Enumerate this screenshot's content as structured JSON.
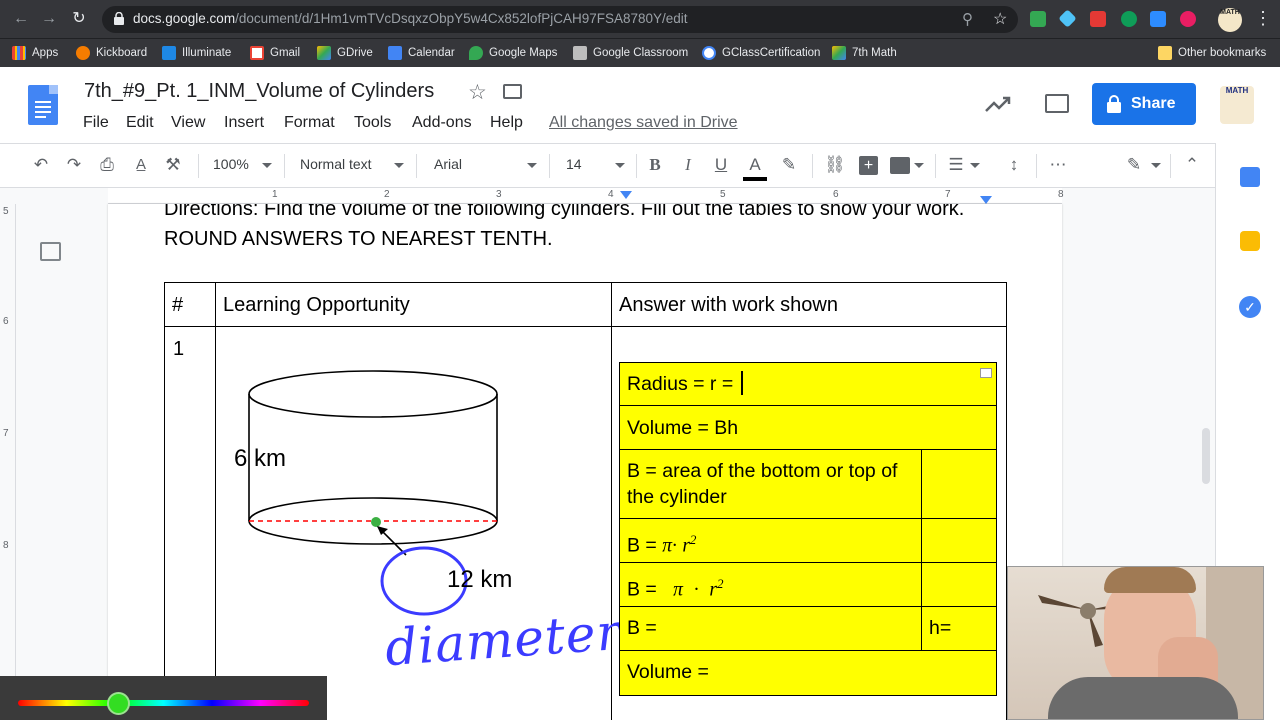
{
  "browser": {
    "url_host": "docs.google.com",
    "url_path": "/document/d/1Hm1vmTVcDsqxzObpY5w4Cx852lofPjCAH97FSA8780Y/edit",
    "bookmarks": [
      "Apps",
      "Kickboard",
      "Illuminate",
      "Gmail",
      "GDrive",
      "Calendar",
      "Google Maps",
      "Google Classroom",
      "GClassCertification",
      "7th Math"
    ],
    "other_bookmarks": "Other bookmarks",
    "profile_badge": "MATH"
  },
  "docs": {
    "title": "7th_#9_Pt. 1_INM_Volume of Cylinders",
    "menu": [
      "File",
      "Edit",
      "View",
      "Insert",
      "Format",
      "Tools",
      "Add-ons",
      "Help"
    ],
    "save_status": "All changes saved in Drive",
    "share_label": "Share"
  },
  "toolbar": {
    "zoom": "100%",
    "style": "Normal text",
    "font": "Arial",
    "font_size": "14"
  },
  "ruler": {
    "marks": [
      "1",
      "2",
      "3",
      "4",
      "5",
      "6",
      "7",
      "8"
    ],
    "vmarks": [
      "5",
      "6",
      "7",
      "8"
    ]
  },
  "document": {
    "directions": "Directions: Find the volume of the following cylinders. Fill out the tables to show your work. ROUND ANSWERS TO NEAREST TENTH.",
    "table_headers": [
      "#",
      "Learning Opportunity",
      "Answer with work shown"
    ],
    "row_number": "1",
    "figure": {
      "height_label": "6 km",
      "diameter_label": "12 km",
      "handwriting": "diameter"
    },
    "answer_table": {
      "radius": "Radius = r =",
      "volume_formula": "Volume = Bh",
      "b_definition": "B = area of the bottom or top of the cylinder",
      "b_formula_1": "B =",
      "b_formula_2": "B =",
      "pi": "π",
      "dot": "·",
      "r": "r",
      "exp": "2",
      "b_result": "B =",
      "h_label": "h=",
      "volume_result": "Volume ="
    }
  },
  "colors": {
    "share_blue": "#1a73e8",
    "highlight_yellow": "#ffff00",
    "ink_blue": "#3b3bff",
    "dashed_red": "#ff0000"
  }
}
